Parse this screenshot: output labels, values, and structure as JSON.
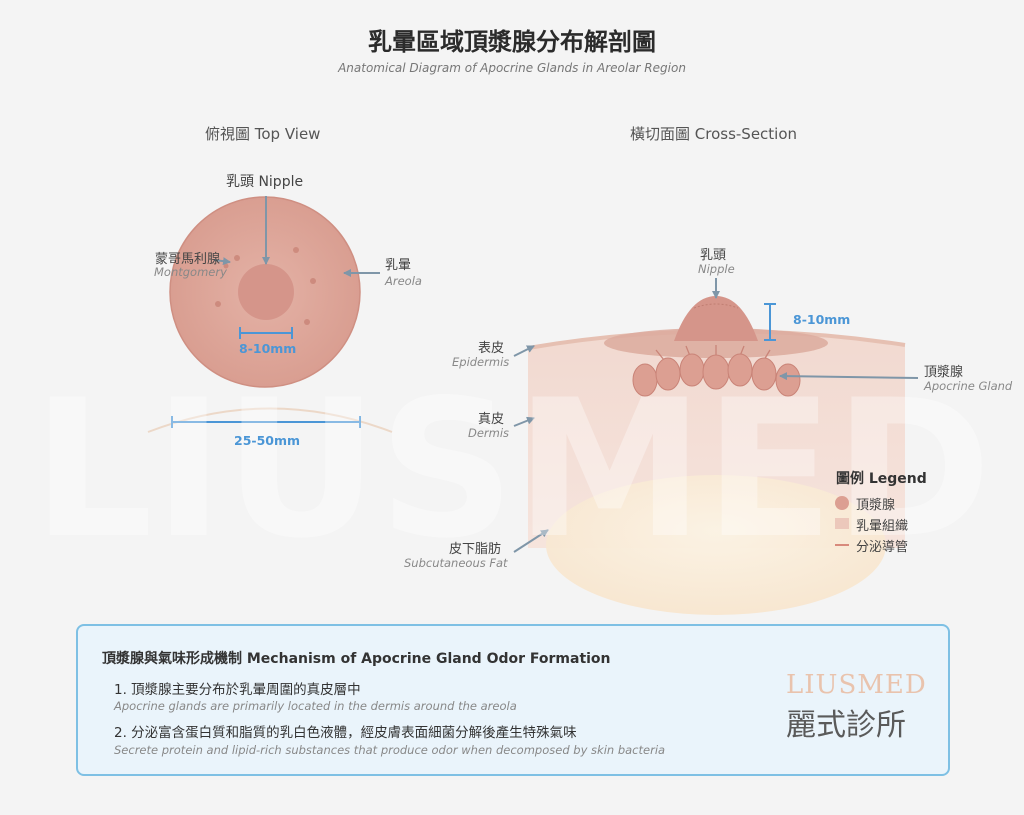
{
  "header": {
    "title": "乳暈區域頂漿腺分布解剖圖",
    "subtitle": "Anatomical Diagram of Apocrine Glands in Areolar Region"
  },
  "watermark": "LIUSMED",
  "top_view": {
    "title": "俯視圖 Top View",
    "nipple_label": "乳頭 Nipple",
    "montgomery_zh": "蒙哥馬利腺",
    "montgomery_en": "Montgomery",
    "areola_zh": "乳暈",
    "areola_en": "Areola",
    "nipple_size": "8-10mm",
    "areola_size": "25-50mm"
  },
  "cross_section": {
    "title": "橫切面圖 Cross-Section",
    "nipple_zh": "乳頭",
    "nipple_en": "Nipple",
    "nipple_height": "8-10mm",
    "epidermis_zh": "表皮",
    "epidermis_en": "Epidermis",
    "dermis_zh": "真皮",
    "dermis_en": "Dermis",
    "fat_zh": "皮下脂肪",
    "fat_en": "Subcutaneous Fat",
    "gland_zh": "頂漿腺",
    "gland_en": "Apocrine Gland"
  },
  "legend": {
    "title": "圖例 Legend",
    "items": [
      {
        "label": "頂漿腺",
        "color": "#d99b8e"
      },
      {
        "label": "乳暈組織",
        "color": "#ecc8bb"
      },
      {
        "label": "分泌導管",
        "color": "#d88a7c"
      }
    ]
  },
  "mechanism": {
    "title": "頂漿腺與氣味形成機制 Mechanism of Apocrine Gland Odor Formation",
    "points": [
      {
        "zh": "1. 頂漿腺主要分布於乳暈周圍的真皮層中",
        "en": "Apocrine glands are primarily located in the dermis around the areola"
      },
      {
        "zh": "2. 分泌富含蛋白質和脂質的乳白色液體，經皮膚表面細菌分解後產生特殊氣味",
        "en": "Secrete protein and lipid-rich substances that produce odor when decomposed by skin bacteria"
      }
    ]
  },
  "brand": {
    "en": "LIUSMED",
    "zh": "麗式診所"
  },
  "colors": {
    "areola": "#dca396",
    "nipple": "#d5958a",
    "dimension": "#4b96d6",
    "arrow": "#7f96a8",
    "box_border": "#7ec0e4",
    "box_fill": "#eaf4fb"
  }
}
